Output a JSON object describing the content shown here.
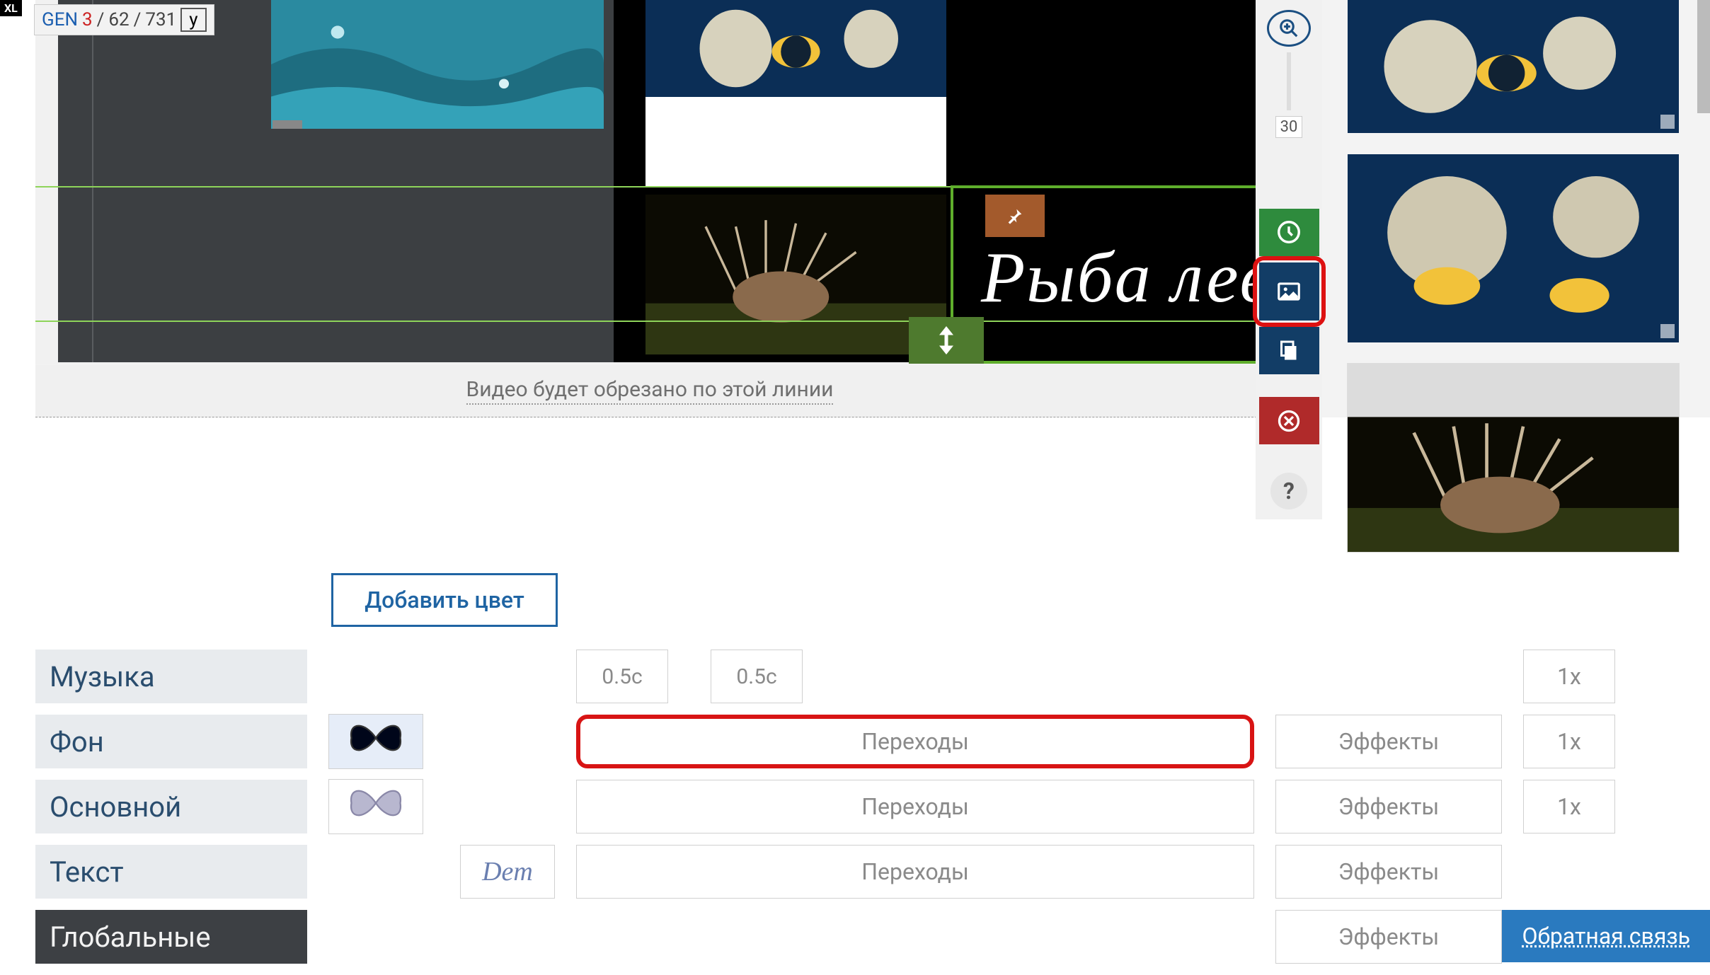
{
  "badge": {
    "xl": "XL"
  },
  "gen_counter": {
    "label": "GEN",
    "a": "3",
    "sep": "/",
    "b": "62",
    "c": "731",
    "y": "y"
  },
  "canvas": {
    "text_overlay": "Рыба лев",
    "crop_note": "Видео будет обрезано по этой линии",
    "zoom_value": "30"
  },
  "toolbar": {
    "zoom_in": "zoom-in",
    "time": "time",
    "image": "image",
    "copy": "copy",
    "delete": "delete",
    "help": "?"
  },
  "right_clips": [
    {
      "kind": "fish-reef"
    },
    {
      "kind": "fish-reef-2"
    },
    {
      "kind": "lionfish"
    }
  ],
  "controls": {
    "add_color": "Добавить цвет",
    "side_tabs": {
      "music": "Музыка",
      "background": "Фон",
      "main": "Основной",
      "text": "Текст",
      "global": "Глобальные"
    },
    "durations": {
      "a": "0.5с",
      "b": "0.5с"
    },
    "speed": "1x",
    "transitions_label": "Переходы",
    "effects_label": "Эффекты",
    "dem_label": "Dem"
  },
  "feedback_label": "Обратная связь"
}
